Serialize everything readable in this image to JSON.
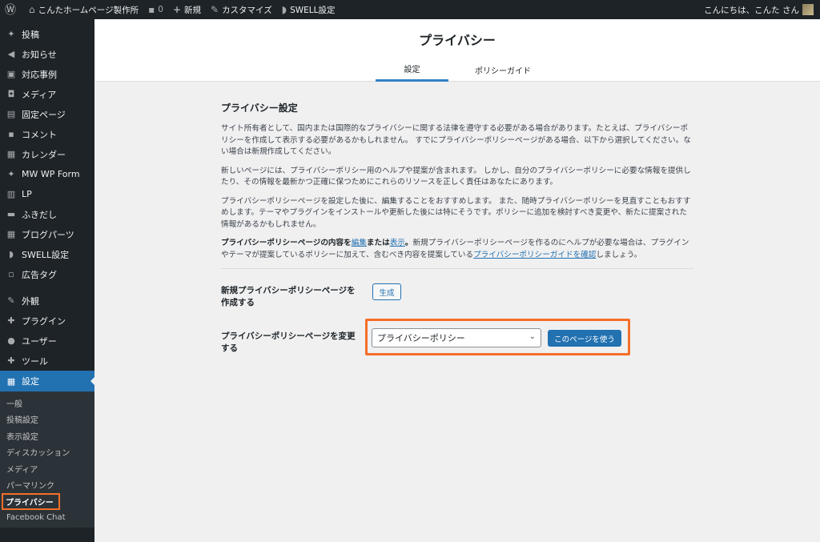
{
  "adminbar": {
    "site_name": "こんたホームページ製作所",
    "comments_count": "0",
    "new_label": "新規",
    "customize_label": "カスタマイズ",
    "swell_label": "SWELL設定",
    "greeting": "こんにちは、こんた さん"
  },
  "sidebar": {
    "items": [
      {
        "label": "投稿",
        "icon": "pin-icon"
      },
      {
        "label": "お知らせ",
        "icon": "megaphone-icon"
      },
      {
        "label": "対応事例",
        "icon": "archive-icon"
      },
      {
        "label": "メディア",
        "icon": "media-icon"
      },
      {
        "label": "固定ページ",
        "icon": "page-icon"
      },
      {
        "label": "コメント",
        "icon": "comment-icon"
      },
      {
        "label": "カレンダー",
        "icon": "calendar-icon"
      },
      {
        "label": "MW WP Form",
        "icon": "pin-icon"
      },
      {
        "label": "LP",
        "icon": "document-icon"
      },
      {
        "label": "ふきだし",
        "icon": "bubble-icon"
      },
      {
        "label": "ブログパーツ",
        "icon": "grid-icon"
      },
      {
        "label": "SWELL設定",
        "icon": "swell-icon"
      },
      {
        "label": "広告タグ",
        "icon": "ad-icon"
      },
      {
        "label": "外観",
        "icon": "brush-icon"
      },
      {
        "label": "プラグイン",
        "icon": "plugin-icon"
      },
      {
        "label": "ユーザー",
        "icon": "user-icon"
      },
      {
        "label": "ツール",
        "icon": "wrench-icon"
      },
      {
        "label": "設定",
        "icon": "settings-icon"
      }
    ],
    "submenu": [
      "一般",
      "投稿設定",
      "表示設定",
      "ディスカッション",
      "メディア",
      "パーマリンク",
      "プライバシー",
      "Facebook Chat"
    ]
  },
  "header": {
    "title": "プライバシー",
    "tabs": [
      "設定",
      "ポリシーガイド"
    ]
  },
  "content": {
    "heading": "プライバシー設定",
    "p1": "サイト所有者として、国内または国際的なプライバシーに関する法律を遵守する必要がある場合があります。たとえば、プライバシーポリシーを作成して表示する必要があるかもしれません。 すでにプライバシーポリシーページがある場合、以下から選択してください。ない場合は新規作成してください。",
    "p2": "新しいページには、プライバシーポリシー用のヘルプや提案が含まれます。 しかし、自分のプライバシーポリシーに必要な情報を提供したり、その情報を最新かつ正確に保つためにこれらのリソースを正しく責任はあなたにあります。",
    "p3": "プライバシーポリシーページを設定した後に、編集することをおすすめします。 また、随時プライバシーポリシーを見直すこともおすすめします。テーマやプラグインをインストールや更新した後には特にそうです。ポリシーに追加を検討すべき変更や、新たに提案された情報があるかもしれません。",
    "p4_bold_a": "プライバシーポリシーページの内容を",
    "p4_edit": "編集",
    "p4_bold_b": "または",
    "p4_view": "表示",
    "p4_bold_c": "。",
    "p4_text": "新規プライバシーポリシーページを作るのにヘルプが必要な場合は、プラグインやテーマが提案しているポリシーに加えて、含むべき内容を提案している",
    "p4_link": "プライバシーポリシーガイドを確認",
    "p4_end": "しましょう。",
    "create_label": "新規プライバシーポリシーページを作成する",
    "create_button": "生成",
    "change_label": "プライバシーポリシーページを変更する",
    "select_value": "プライバシーポリシー",
    "use_button": "このページを使う"
  }
}
